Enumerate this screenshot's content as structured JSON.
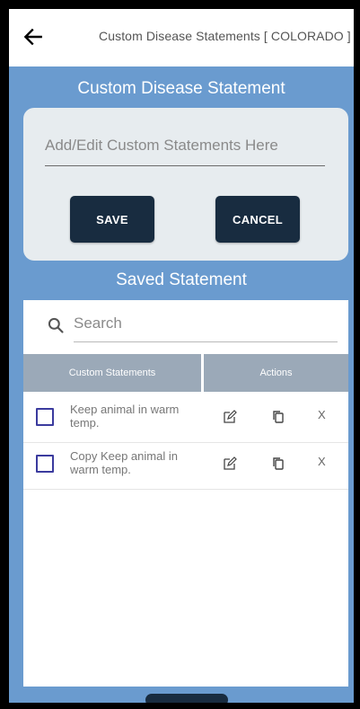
{
  "header": {
    "title": "Custom Disease Statements [ COLORADO ]"
  },
  "editor": {
    "heading": "Custom Disease Statement",
    "placeholder": "Add/Edit Custom Statements Here",
    "save_label": "SAVE",
    "cancel_label": "CANCEL"
  },
  "saved": {
    "heading": "Saved Statement",
    "search_placeholder": "Search",
    "columns": [
      "Custom Statements",
      "Actions"
    ],
    "rows": [
      {
        "text": "Keep animal in warm temp.",
        "close": "X"
      },
      {
        "text": "Copy Keep animal in warm temp.",
        "close": "X"
      }
    ]
  },
  "icons": {
    "back": "arrow-left-icon",
    "search": "search-icon",
    "edit": "edit-icon",
    "copy": "copy-icon"
  },
  "colors": {
    "background": "#6a9bcf",
    "button": "#182c40",
    "table_header": "#9ba9b8",
    "checkbox": "#3b3b9e"
  }
}
